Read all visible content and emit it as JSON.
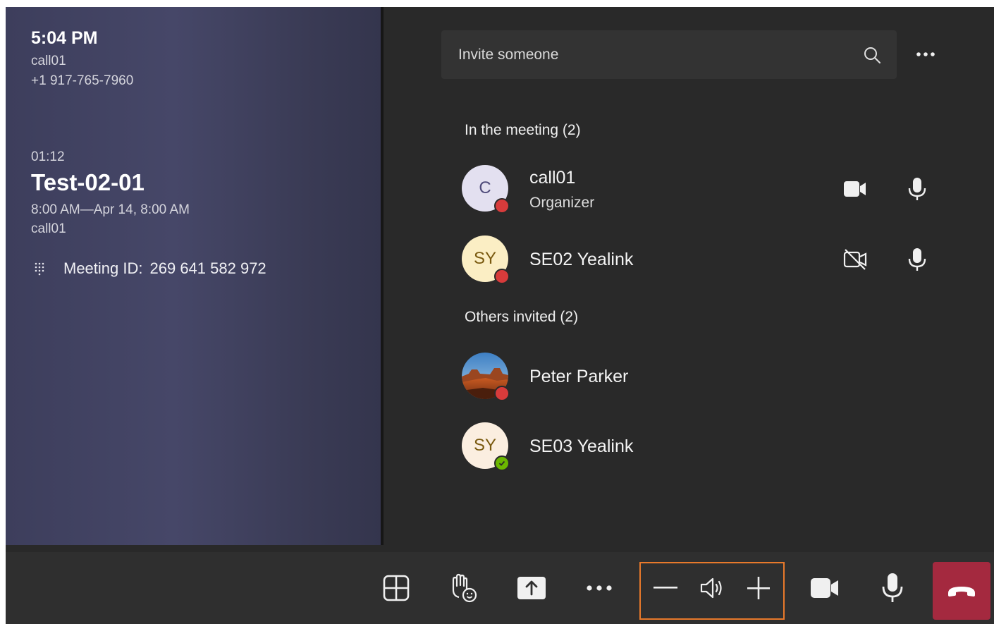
{
  "call": {
    "time": "5:04 PM",
    "caller_name": "call01",
    "caller_number": "+1 917-765-7960"
  },
  "meeting": {
    "duration": "01:12",
    "title": "Test-02-01",
    "time_range": "8:00 AM—Apr 14, 8:00 AM",
    "organizer": "call01",
    "id_label": "Meeting ID:",
    "id_value": "269 641 582 972"
  },
  "invite": {
    "placeholder": "Invite someone"
  },
  "in_meeting": {
    "header": "In the meeting (2)",
    "people": [
      {
        "initials": "C",
        "name": "call01",
        "role": "Organizer",
        "presence": "busy",
        "video": "video-icon",
        "mic": "mic-icon",
        "avatar_bg": "#e3e0f0",
        "avatar_fg": "#4e4a7a"
      },
      {
        "initials": "SY",
        "name": "SE02 Yealink",
        "role": "",
        "presence": "busy",
        "video": "video-off-icon",
        "mic": "mic-icon",
        "avatar_bg": "#fbeec4",
        "avatar_fg": "#7a5a10"
      }
    ]
  },
  "invited": {
    "header": "Others invited (2)",
    "people": [
      {
        "initials": "",
        "name": "Peter Parker",
        "presence": "busy",
        "avatar": "landscape-photo"
      },
      {
        "initials": "SY",
        "name": "SE03 Yealink",
        "presence": "available",
        "avatar_bg": "#fbeee0",
        "avatar_fg": "#7a5a10"
      }
    ]
  },
  "colors": {
    "busy": "#d83b3b",
    "available": "#6bb700",
    "hangup": "#a4293f",
    "highlight": "#e8792b"
  },
  "toolbar": {
    "buttons": [
      "layout-icon",
      "raise-hand-icon",
      "share-icon",
      "more-icon",
      "volume-down-icon",
      "speaker-icon",
      "volume-up-icon",
      "video-icon",
      "mic-icon",
      "hangup-icon"
    ]
  }
}
